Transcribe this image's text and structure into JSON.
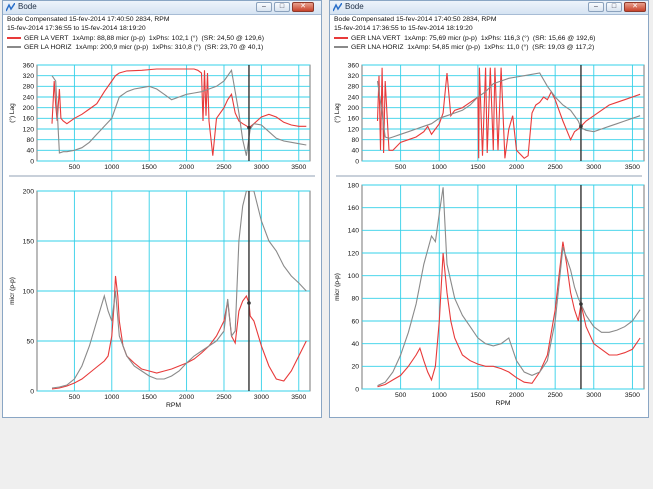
{
  "colors": {
    "grid": "#33d0e8",
    "red": "#e83a3a",
    "gray": "#8a8a8a",
    "cursor": "#333333"
  },
  "windows": [
    {
      "id": "left",
      "title": "Bode",
      "header_line1": "Bode   Compensated   15-fev-2014 17:40:50   2834, RPM",
      "header_line2": "15-fev-2014 17:36:55  to  15-fev-2014 18:19:20",
      "legend": [
        {
          "name": "GER LA VERT",
          "amp": "1xAmp: 88,88 micr (p-p)",
          "phs": "1xPhs: 102,1 (°)",
          "sr": "(SR: 24,50 @ 129,6)",
          "color": "#e83a3a"
        },
        {
          "name": "GER LA HORIZ",
          "amp": "1xAmp: 200,9 micr (p-p)",
          "phs": "1xPhs: 310,8 (°)",
          "sr": "(SR: 23,70 @ 40,1)",
          "color": "#8a8a8a"
        }
      ]
    },
    {
      "id": "right",
      "title": "Bode",
      "header_line1": "Bode   Compensated   15-fev-2014 17:40:50   2834, RPM",
      "header_line2": "15-fev-2014 17:36:55  to  15-fev-2014 18:19:20",
      "legend": [
        {
          "name": "GER LNA VERT",
          "amp": "1xAmp: 75,69 micr (p-p)",
          "phs": "1xPhs: 116,3 (°)",
          "sr": "(SR: 15,66 @ 192,6)",
          "color": "#e83a3a"
        },
        {
          "name": "GER LNA HORIZ",
          "amp": "1xAmp: 54,85 micr (p-p)",
          "phs": "1xPhs: 11,0 (°)",
          "sr": "(SR: 19,03 @ 117,2)",
          "color": "#8a8a8a"
        }
      ]
    }
  ],
  "chart_data": [
    {
      "type": "line",
      "window": "left",
      "panel": "phase",
      "xlabel": "",
      "ylabel": "(°) Lag",
      "xlim": [
        0,
        3650
      ],
      "ylim": [
        0,
        360
      ],
      "xticks": [
        500,
        1000,
        1500,
        2000,
        2500,
        3000,
        3500
      ],
      "yticks": [
        0,
        40,
        80,
        120,
        160,
        200,
        240,
        280,
        320,
        360
      ],
      "cursor_x": 2834,
      "series": [
        {
          "name": "GER LA VERT",
          "color": "#e83a3a",
          "x": [
            200,
            230,
            250,
            270,
            300,
            320,
            350,
            400,
            500,
            600,
            700,
            800,
            900,
            1000,
            1050,
            1100,
            1200,
            1400,
            1600,
            1800,
            2000,
            2100,
            2150,
            2200,
            2220,
            2240,
            2260,
            2280,
            2300,
            2350,
            2400,
            2500,
            2550,
            2600,
            2650,
            2700,
            2750,
            2800,
            2834,
            2900,
            3000,
            3100,
            3200,
            3300,
            3400,
            3500,
            3600
          ],
          "y": [
            140,
            300,
            210,
            150,
            270,
            160,
            150,
            140,
            160,
            175,
            195,
            215,
            260,
            300,
            320,
            330,
            338,
            340,
            345,
            345,
            345,
            345,
            340,
            330,
            150,
            340,
            170,
            330,
            150,
            20,
            160,
            200,
            230,
            250,
            180,
            150,
            140,
            132,
            125,
            140,
            165,
            175,
            165,
            145,
            135,
            130,
            130
          ]
        },
        {
          "name": "GER LA HORIZ",
          "color": "#8a8a8a",
          "x": [
            200,
            250,
            300,
            350,
            400,
            500,
            600,
            700,
            800,
            900,
            1000,
            1050,
            1100,
            1200,
            1300,
            1400,
            1500,
            1600,
            1700,
            1800,
            1900,
            2000,
            2100,
            2200,
            2300,
            2400,
            2500,
            2600,
            2650,
            2700,
            2750,
            2800,
            2850,
            2900,
            3000,
            3100,
            3200,
            3300,
            3400,
            3500,
            3600
          ],
          "y": [
            320,
            300,
            30,
            35,
            35,
            40,
            50,
            70,
            100,
            130,
            160,
            200,
            240,
            260,
            270,
            275,
            280,
            270,
            250,
            230,
            240,
            250,
            255,
            260,
            270,
            280,
            300,
            340,
            260,
            180,
            80,
            20,
            120,
            140,
            135,
            110,
            85,
            75,
            70,
            65,
            60
          ]
        }
      ]
    },
    {
      "type": "line",
      "window": "left",
      "panel": "amplitude",
      "xlabel": "RPM",
      "ylabel": "micr (p-p)",
      "xlim": [
        0,
        3650
      ],
      "ylim": [
        0,
        200
      ],
      "xticks": [
        500,
        1000,
        1500,
        2000,
        2500,
        3000,
        3500
      ],
      "yticks": [
        0,
        50,
        100,
        150,
        200
      ],
      "cursor_x": 2834,
      "series": [
        {
          "name": "GER LA VERT",
          "color": "#e83a3a",
          "x": [
            200,
            300,
            400,
            500,
            600,
            700,
            800,
            900,
            950,
            1000,
            1030,
            1050,
            1080,
            1100,
            1150,
            1200,
            1300,
            1400,
            1500,
            1600,
            1700,
            1800,
            1900,
            2000,
            2100,
            2200,
            2300,
            2400,
            2500,
            2550,
            2600,
            2650,
            2700,
            2750,
            2800,
            2834,
            2850,
            2900,
            3000,
            3100,
            3200,
            3300,
            3400,
            3500,
            3600
          ],
          "y": [
            2,
            3,
            5,
            8,
            12,
            18,
            24,
            30,
            35,
            55,
            85,
            115,
            95,
            70,
            45,
            35,
            28,
            22,
            20,
            18,
            20,
            22,
            25,
            28,
            32,
            38,
            45,
            55,
            70,
            90,
            55,
            48,
            80,
            90,
            95,
            88,
            75,
            70,
            45,
            25,
            12,
            10,
            20,
            35,
            50
          ]
        },
        {
          "name": "GER LA HORIZ",
          "color": "#8a8a8a",
          "x": [
            200,
            300,
            400,
            500,
            600,
            700,
            800,
            900,
            950,
            1000,
            1050,
            1100,
            1200,
            1300,
            1400,
            1500,
            1600,
            1700,
            1800,
            1900,
            2000,
            2100,
            2200,
            2300,
            2400,
            2500,
            2550,
            2600,
            2650,
            2700,
            2750,
            2800,
            2834,
            2900,
            3000,
            3100,
            3200,
            3300,
            3400,
            3500,
            3600
          ],
          "y": [
            3,
            4,
            6,
            12,
            25,
            45,
            70,
            95,
            80,
            70,
            100,
            55,
            35,
            25,
            20,
            15,
            12,
            12,
            15,
            20,
            28,
            35,
            40,
            45,
            50,
            60,
            92,
            55,
            60,
            150,
            185,
            200,
            200,
            200,
            170,
            150,
            140,
            125,
            115,
            108,
            100
          ]
        }
      ]
    },
    {
      "type": "line",
      "window": "right",
      "panel": "phase",
      "xlabel": "",
      "ylabel": "(°) Lag",
      "xlim": [
        0,
        3650
      ],
      "ylim": [
        0,
        360
      ],
      "xticks": [
        500,
        1000,
        1500,
        2000,
        2500,
        3000,
        3500
      ],
      "yticks": [
        0,
        40,
        80,
        120,
        160,
        200,
        240,
        280,
        320,
        360
      ],
      "cursor_x": 2834,
      "series": [
        {
          "name": "GER LNA VERT",
          "color": "#e83a3a",
          "x": [
            200,
            220,
            240,
            260,
            280,
            300,
            350,
            400,
            500,
            600,
            700,
            800,
            850,
            900,
            950,
            1000,
            1050,
            1100,
            1150,
            1200,
            1300,
            1400,
            1500,
            1510,
            1520,
            1560,
            1600,
            1620,
            1660,
            1700,
            1720,
            1760,
            1800,
            1850,
            1900,
            1950,
            2000,
            2100,
            2150,
            2200,
            2250,
            2300,
            2350,
            2400,
            2450,
            2500,
            2550,
            2600,
            2700,
            2750,
            2800,
            2834,
            2900,
            3000,
            3100,
            3200,
            3300,
            3400,
            3500,
            3600
          ],
          "y": [
            150,
            320,
            40,
            350,
            30,
            300,
            40,
            40,
            70,
            80,
            90,
            110,
            130,
            100,
            120,
            140,
            180,
            330,
            170,
            190,
            200,
            220,
            240,
            10,
            350,
            20,
            350,
            30,
            350,
            40,
            350,
            40,
            350,
            10,
            120,
            170,
            40,
            10,
            20,
            180,
            210,
            220,
            240,
            230,
            260,
            230,
            190,
            150,
            80,
            110,
            120,
            130,
            150,
            170,
            190,
            210,
            220,
            230,
            240,
            250
          ]
        },
        {
          "name": "GER LNA HORIZ",
          "color": "#8a8a8a",
          "x": [
            200,
            250,
            300,
            350,
            400,
            500,
            600,
            700,
            800,
            900,
            1000,
            1100,
            1200,
            1300,
            1400,
            1500,
            1600,
            1700,
            1800,
            1900,
            2000,
            2100,
            2200,
            2300,
            2400,
            2500,
            2600,
            2700,
            2800,
            2834,
            2900,
            3000,
            3100,
            3200,
            3300,
            3400,
            3500,
            3600
          ],
          "y": [
            300,
            200,
            90,
            85,
            90,
            100,
            110,
            120,
            130,
            140,
            160,
            170,
            180,
            190,
            210,
            240,
            260,
            290,
            300,
            310,
            315,
            320,
            325,
            330,
            280,
            240,
            210,
            190,
            150,
            125,
            115,
            110,
            120,
            130,
            140,
            150,
            160,
            170
          ]
        }
      ]
    },
    {
      "type": "line",
      "window": "right",
      "panel": "amplitude",
      "xlabel": "RPM",
      "ylabel": "micr (p-p)",
      "xlim": [
        0,
        3650
      ],
      "ylim": [
        0,
        180
      ],
      "xticks": [
        500,
        1000,
        1500,
        2000,
        2500,
        3000,
        3500
      ],
      "yticks": [
        0,
        20,
        40,
        60,
        80,
        100,
        120,
        140,
        160,
        180
      ],
      "cursor_x": 2834,
      "series": [
        {
          "name": "GER LNA VERT",
          "color": "#e83a3a",
          "x": [
            200,
            300,
            400,
            500,
            600,
            700,
            750,
            800,
            850,
            900,
            950,
            1000,
            1050,
            1100,
            1150,
            1200,
            1300,
            1400,
            1500,
            1600,
            1700,
            1800,
            1900,
            2000,
            2100,
            2200,
            2300,
            2400,
            2500,
            2550,
            2600,
            2650,
            2700,
            2750,
            2800,
            2834,
            2900,
            3000,
            3100,
            3200,
            3300,
            3400,
            3500,
            3600
          ],
          "y": [
            2,
            4,
            8,
            12,
            20,
            30,
            36,
            25,
            15,
            8,
            20,
            60,
            120,
            85,
            60,
            45,
            30,
            25,
            22,
            20,
            20,
            18,
            15,
            10,
            6,
            5,
            15,
            30,
            70,
            100,
            130,
            110,
            85,
            70,
            60,
            75,
            55,
            40,
            35,
            30,
            30,
            32,
            35,
            45
          ]
        },
        {
          "name": "GER LNA HORIZ",
          "color": "#8a8a8a",
          "x": [
            200,
            300,
            400,
            500,
            600,
            700,
            800,
            900,
            950,
            1000,
            1050,
            1100,
            1200,
            1300,
            1400,
            1500,
            1600,
            1700,
            1800,
            1900,
            2000,
            2100,
            2200,
            2300,
            2400,
            2500,
            2600,
            2700,
            2750,
            2800,
            2834,
            2900,
            3000,
            3100,
            3200,
            3300,
            3400,
            3500,
            3600
          ],
          "y": [
            3,
            6,
            15,
            30,
            50,
            75,
            110,
            135,
            130,
            155,
            178,
            110,
            80,
            65,
            55,
            45,
            40,
            38,
            40,
            45,
            25,
            15,
            12,
            15,
            25,
            60,
            125,
            105,
            90,
            80,
            75,
            65,
            55,
            50,
            50,
            52,
            55,
            60,
            70
          ]
        }
      ]
    }
  ]
}
